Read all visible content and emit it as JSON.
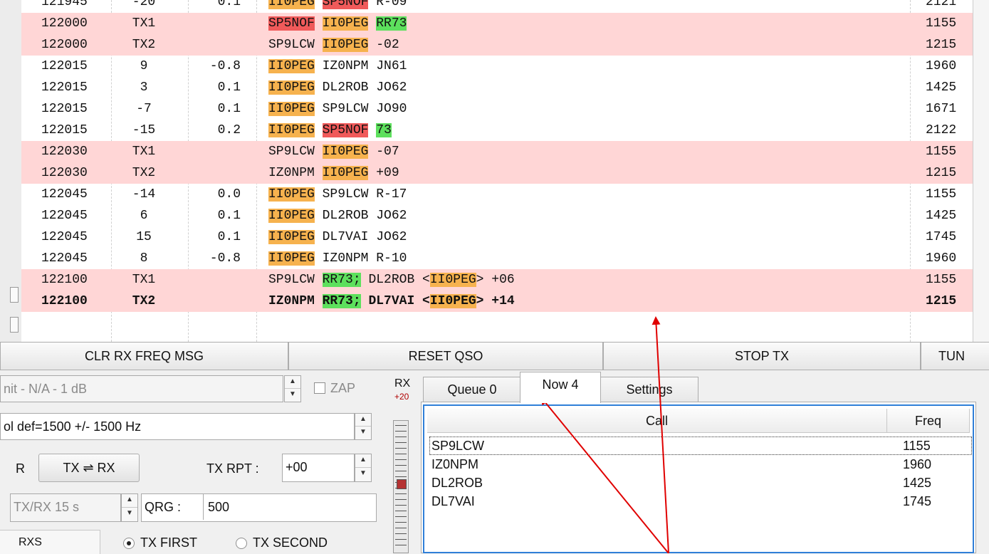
{
  "log": {
    "rows": [
      {
        "time": "121945",
        "db": "-20",
        "dt": "0.1",
        "fr": "2121",
        "tx": false,
        "bold": false,
        "tokens": [
          {
            "t": "II0PEG",
            "s": "me"
          },
          {
            "t": " "
          },
          {
            "t": "SP5NOF",
            "s": "red"
          },
          {
            "t": " R-09"
          }
        ]
      },
      {
        "time": "122000",
        "db": "TX1",
        "dt": "",
        "fr": "1155",
        "tx": true,
        "bold": false,
        "tokens": [
          {
            "t": "SP5NOF",
            "s": "red"
          },
          {
            "t": " "
          },
          {
            "t": "II0PEG",
            "s": "me"
          },
          {
            "t": " "
          },
          {
            "t": "RR73",
            "s": "grn"
          }
        ]
      },
      {
        "time": "122000",
        "db": "TX2",
        "dt": "",
        "fr": "1215",
        "tx": true,
        "bold": false,
        "tokens": [
          {
            "t": "SP9LCW "
          },
          {
            "t": "II0PEG",
            "s": "me"
          },
          {
            "t": " -02"
          }
        ]
      },
      {
        "time": "122015",
        "db": "9",
        "dt": "-0.8",
        "fr": "1960",
        "tx": false,
        "bold": false,
        "tokens": [
          {
            "t": "II0PEG",
            "s": "me"
          },
          {
            "t": " IZ0NPM JN61"
          }
        ]
      },
      {
        "time": "122015",
        "db": "3",
        "dt": "0.1",
        "fr": "1425",
        "tx": false,
        "bold": false,
        "tokens": [
          {
            "t": "II0PEG",
            "s": "me"
          },
          {
            "t": " DL2ROB JO62"
          }
        ]
      },
      {
        "time": "122015",
        "db": "-7",
        "dt": "0.1",
        "fr": "1671",
        "tx": false,
        "bold": false,
        "tokens": [
          {
            "t": "II0PEG",
            "s": "me"
          },
          {
            "t": " SP9LCW JO90"
          }
        ]
      },
      {
        "time": "122015",
        "db": "-15",
        "dt": "0.2",
        "fr": "2122",
        "tx": false,
        "bold": false,
        "tokens": [
          {
            "t": "II0PEG",
            "s": "me"
          },
          {
            "t": " "
          },
          {
            "t": "SP5NOF",
            "s": "red"
          },
          {
            "t": " "
          },
          {
            "t": "73",
            "s": "grn"
          }
        ]
      },
      {
        "time": "122030",
        "db": "TX1",
        "dt": "",
        "fr": "1155",
        "tx": true,
        "bold": false,
        "tokens": [
          {
            "t": "SP9LCW "
          },
          {
            "t": "II0PEG",
            "s": "me"
          },
          {
            "t": " -07"
          }
        ]
      },
      {
        "time": "122030",
        "db": "TX2",
        "dt": "",
        "fr": "1215",
        "tx": true,
        "bold": false,
        "tokens": [
          {
            "t": "IZ0NPM "
          },
          {
            "t": "II0PEG",
            "s": "me"
          },
          {
            "t": " +09"
          }
        ]
      },
      {
        "time": "122045",
        "db": "-14",
        "dt": "0.0",
        "fr": "1155",
        "tx": false,
        "bold": false,
        "tokens": [
          {
            "t": "II0PEG",
            "s": "me"
          },
          {
            "t": " SP9LCW R-17"
          }
        ]
      },
      {
        "time": "122045",
        "db": "6",
        "dt": "0.1",
        "fr": "1425",
        "tx": false,
        "bold": false,
        "tokens": [
          {
            "t": "II0PEG",
            "s": "me"
          },
          {
            "t": " DL2ROB JO62"
          }
        ]
      },
      {
        "time": "122045",
        "db": "15",
        "dt": "0.1",
        "fr": "1745",
        "tx": false,
        "bold": false,
        "tokens": [
          {
            "t": "II0PEG",
            "s": "me"
          },
          {
            "t": " DL7VAI JO62"
          }
        ]
      },
      {
        "time": "122045",
        "db": "8",
        "dt": "-0.8",
        "fr": "1960",
        "tx": false,
        "bold": false,
        "tokens": [
          {
            "t": "II0PEG",
            "s": "me"
          },
          {
            "t": " IZ0NPM R-10"
          }
        ]
      },
      {
        "time": "122100",
        "db": "TX1",
        "dt": "",
        "fr": "1155",
        "tx": true,
        "bold": false,
        "tokens": [
          {
            "t": "SP9LCW "
          },
          {
            "t": "RR73;",
            "s": "grn"
          },
          {
            "t": " DL2ROB <"
          },
          {
            "t": "II0PEG",
            "s": "me"
          },
          {
            "t": "> +06"
          }
        ]
      },
      {
        "time": "122100",
        "db": "TX2",
        "dt": "",
        "fr": "1215",
        "tx": true,
        "bold": true,
        "tokens": [
          {
            "t": "IZ0NPM "
          },
          {
            "t": "RR73;",
            "s": "grn"
          },
          {
            "t": " DL7VAI <"
          },
          {
            "t": "II0PEG",
            "s": "me"
          },
          {
            "t": "> +14"
          }
        ]
      }
    ]
  },
  "buttons": {
    "clr_rx": "CLR RX FREQ MSG",
    "reset_qso": "RESET QSO",
    "stop_tx": "STOP TX",
    "tune": "TUN"
  },
  "left": {
    "limit_field": "nit - N/A - 1  dB",
    "zap_label": "ZAP",
    "bandwidth_field": "ol def=1500 +/-  1500  Hz",
    "tr_label": "R",
    "tx_rx_button": "TX ⇌ RX",
    "tx_rpt_label": "TX RPT :",
    "tx_rpt_value": "+00",
    "period_field": "TX/RX 15  s",
    "qrg_label": "QRG :",
    "qrg_value": "500",
    "rxs_tab": "RXS",
    "tx_first": "TX FIRST",
    "tx_second": "TX SECOND"
  },
  "meter": {
    "label": "RX",
    "value": "+20"
  },
  "tabs": [
    {
      "label": "Queue 0",
      "active": false
    },
    {
      "label": "Now 4",
      "active": true
    },
    {
      "label": "Settings",
      "active": false
    }
  ],
  "table": {
    "headers": [
      "Call",
      "Freq"
    ],
    "rows": [
      {
        "call": "SP9LCW",
        "freq": "1155"
      },
      {
        "call": "IZ0NPM",
        "freq": "1960"
      },
      {
        "call": "DL2ROB",
        "freq": "1425"
      },
      {
        "call": "DL7VAI",
        "freq": "1745"
      }
    ]
  },
  "colors": {
    "tx_row": "#ffd6d6",
    "my_call": "#f6b24e",
    "other_call": "#f05a5a",
    "rr73": "#5de05d",
    "arrow": "#e00000",
    "focus": "#2f7fd8"
  }
}
